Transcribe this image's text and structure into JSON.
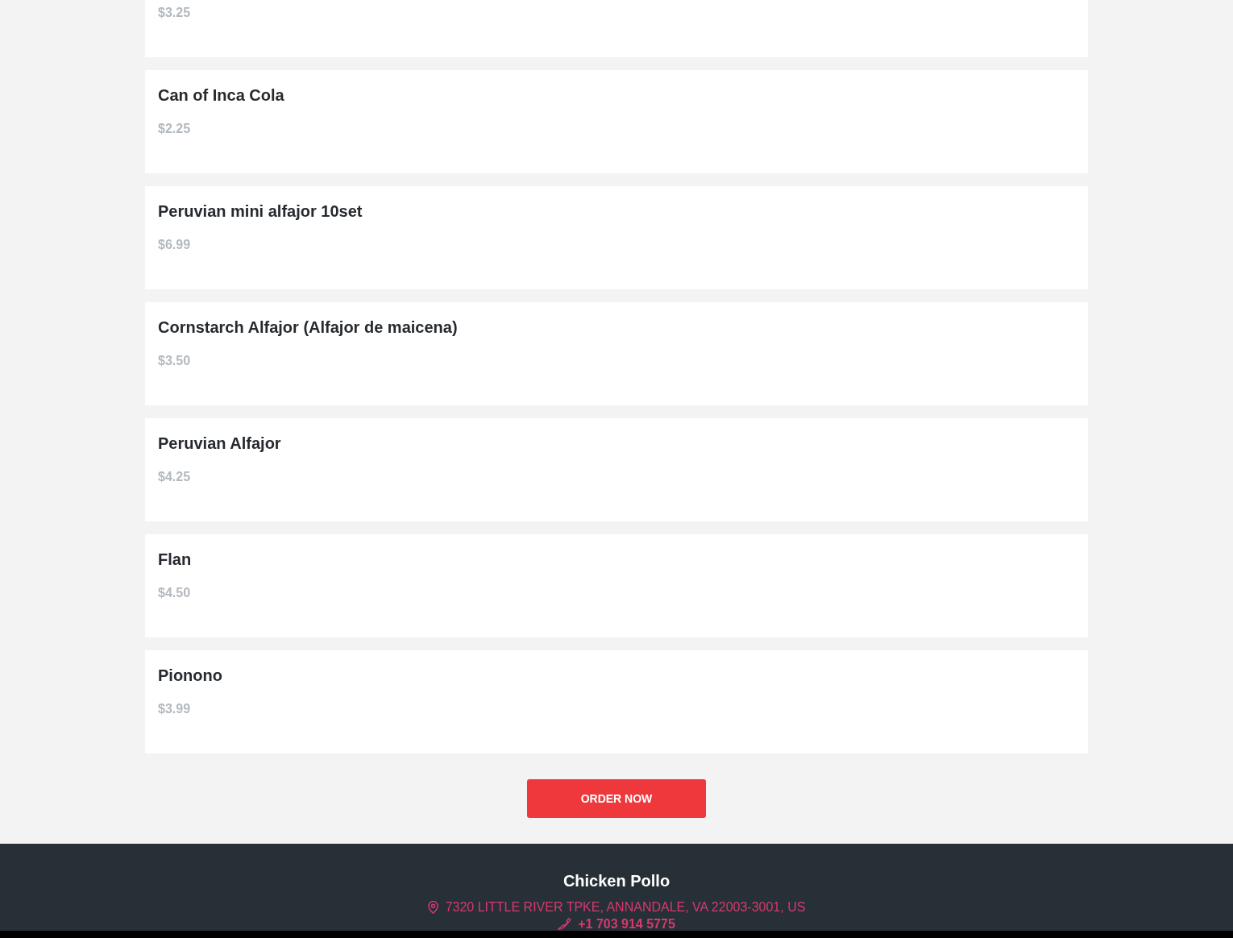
{
  "menu_items": [
    {
      "price": "$3.25"
    },
    {
      "name": "Can of Inca Cola",
      "price": "$2.25"
    },
    {
      "name": "Peruvian mini alfajor 10set",
      "price": "$6.99"
    },
    {
      "name": "Cornstarch Alfajor (Alfajor de maicena)",
      "price": "$3.50"
    },
    {
      "name": "Peruvian Alfajor",
      "price": "$4.25"
    },
    {
      "name": "Flan",
      "price": "$4.50"
    },
    {
      "name": "Pionono",
      "price": "$3.99"
    }
  ],
  "order_button": {
    "label": "ORDER NOW"
  },
  "footer": {
    "restaurant_name": "Chicken Pollo",
    "address": "7320 LITTLE RIVER TPKE, ANNANDALE, VA 22003-3001, US",
    "phone": "+1 703 914 5775"
  }
}
